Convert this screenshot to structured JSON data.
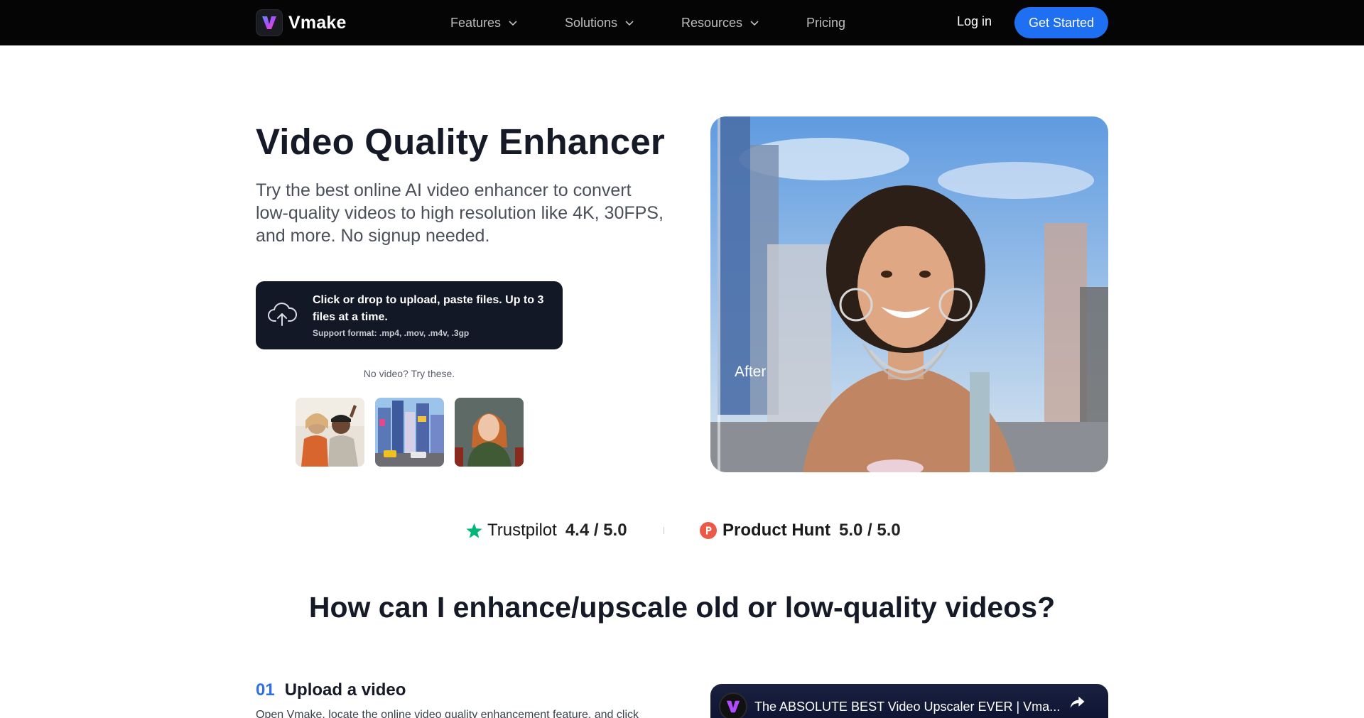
{
  "nav": {
    "brand": "Vmake",
    "items": [
      {
        "label": "Features",
        "has_dropdown": true
      },
      {
        "label": "Solutions",
        "has_dropdown": true
      },
      {
        "label": "Resources",
        "has_dropdown": true
      },
      {
        "label": "Pricing",
        "has_dropdown": false
      }
    ],
    "login_label": "Log in",
    "cta_label": "Get Started",
    "accent": "#1f6ff2"
  },
  "hero": {
    "title": "Video Quality Enhancer",
    "subtitle": "Try the best online AI video enhancer to convert low-quality videos to high resolution like 4K, 30FPS, and more. No signup needed.",
    "upload": {
      "main": "Click or drop to upload, paste files. Up to 3 files at a time.",
      "formats": "Support format: .mp4, .mov, .m4v, .3gp"
    },
    "try_text": "No video? Try these.",
    "sample_count_icons": [
      "friends-selfie-thumbnail",
      "city-street-thumbnail",
      "woman-portrait-thumbnail"
    ],
    "media_label": "After"
  },
  "ratings": {
    "trustpilot": {
      "brand": "Trustpilot",
      "score": "4.4 / 5.0",
      "color": "#00b67a"
    },
    "producthunt": {
      "brand": "Product Hunt",
      "score": "5.0 / 5.0",
      "color": "#ea5a47"
    }
  },
  "how_to": {
    "title": "How can I enhance/upscale old or low-quality videos?",
    "steps": [
      {
        "num": "01",
        "title": "Upload a video",
        "desc": "Open Vmake, locate the online video quality enhancement feature, and click"
      }
    ],
    "video": {
      "title": "The ABSOLUTE BEST Video Upscaler EVER | Vma..."
    }
  }
}
